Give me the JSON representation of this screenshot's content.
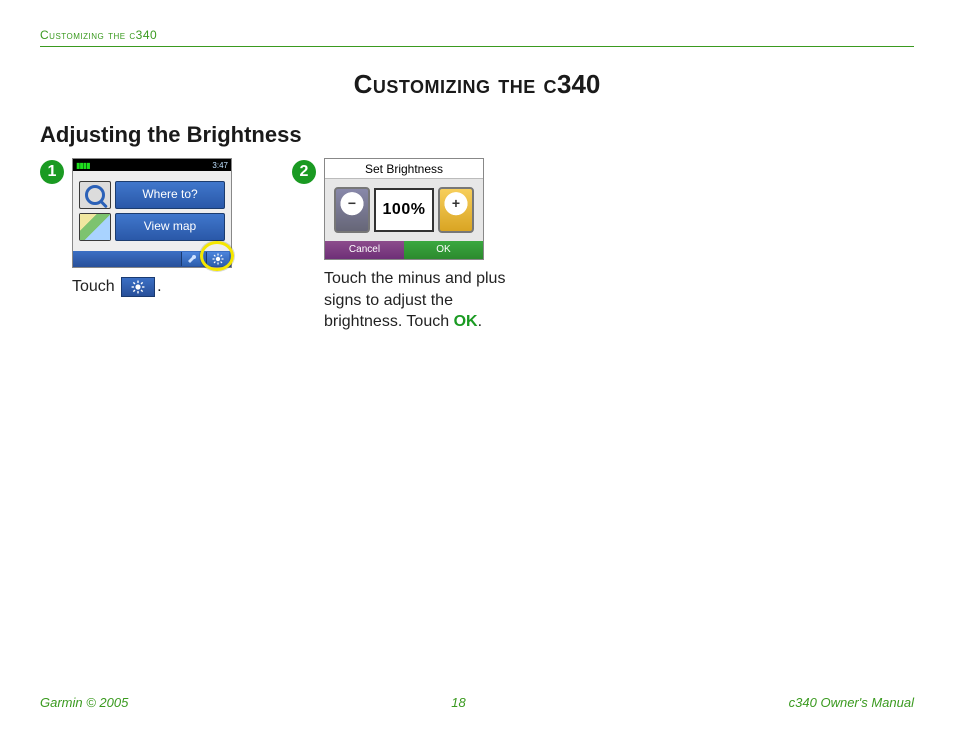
{
  "running_header": "Customizing the c340",
  "title_sc": "Customizing the c",
  "title_num": "340",
  "section_heading": "Adjusting the Brightness",
  "steps": [
    {
      "number": "➊",
      "caption_prefix": "Touch ",
      "caption_suffix": ".",
      "screenshot": {
        "time": "3:47",
        "menu_items": [
          "Where to?",
          "View map"
        ]
      }
    },
    {
      "number": "➋",
      "caption_prefix": "Touch the minus and plus signs to adjust the brightness. Touch ",
      "caption_ok": "OK",
      "caption_suffix": ".",
      "screenshot": {
        "title": "Set Brightness",
        "value": "100%",
        "cancel": "Cancel",
        "ok": "OK"
      }
    }
  ],
  "footer": {
    "left": "Garmin © 2005",
    "center": "18",
    "right": "c340 Owner's Manual"
  }
}
